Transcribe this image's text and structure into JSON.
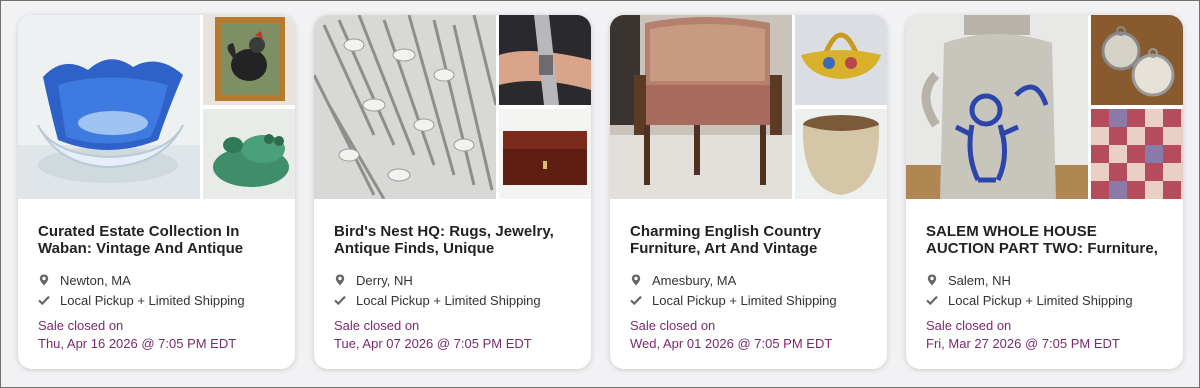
{
  "cards": [
    {
      "title": "Curated Estate Collection In Waban: Vintage And Antique",
      "location": "Newton, MA",
      "shipping": "Local Pickup + Limited Shipping",
      "status": "Sale closed on",
      "date": "Thu, Apr 16 2026 @ 7:05 PM EDT",
      "images": [
        "blue-glass-bowl-photo",
        "rooster-painting-photo",
        "green-frog-planter-photo"
      ]
    },
    {
      "title": "Bird's Nest HQ: Rugs, Jewelry, Antique Finds, Unique",
      "location": "Derry, NH",
      "shipping": "Local Pickup + Limited Shipping",
      "status": "Sale closed on",
      "date": "Tue, Apr 07 2026 @ 7:05 PM EDT",
      "images": [
        "silver-flatware-photo",
        "bracelet-photo",
        "wooden-box-photo"
      ]
    },
    {
      "title": "Charming English Country Furniture, Art And Vintage",
      "location": "Amesbury, MA",
      "shipping": "Local Pickup + Limited Shipping",
      "status": "Sale closed on",
      "date": "Wed, Apr 01 2026 @ 7:05 PM EDT",
      "images": [
        "upholstered-settee-photo",
        "pottery-basket-photo",
        "stoneware-crock-photo"
      ]
    },
    {
      "title": "SALEM WHOLE HOUSE AUCTION PART TWO: Furniture,",
      "location": "Salem, NH",
      "shipping": "Local Pickup + Limited Shipping",
      "status": "Sale closed on",
      "date": "Fri, Mar 27 2026 @ 7:05 PM EDT",
      "images": [
        "stoneware-churn-photo",
        "pocket-watches-photo",
        "patchwork-quilt-photo"
      ]
    }
  ],
  "colors": {
    "status": "#7a2a6e",
    "title": "#222222",
    "icon": "#666666"
  },
  "icons": {
    "location": "map-pin-icon",
    "shipping": "checkmark-icon"
  }
}
